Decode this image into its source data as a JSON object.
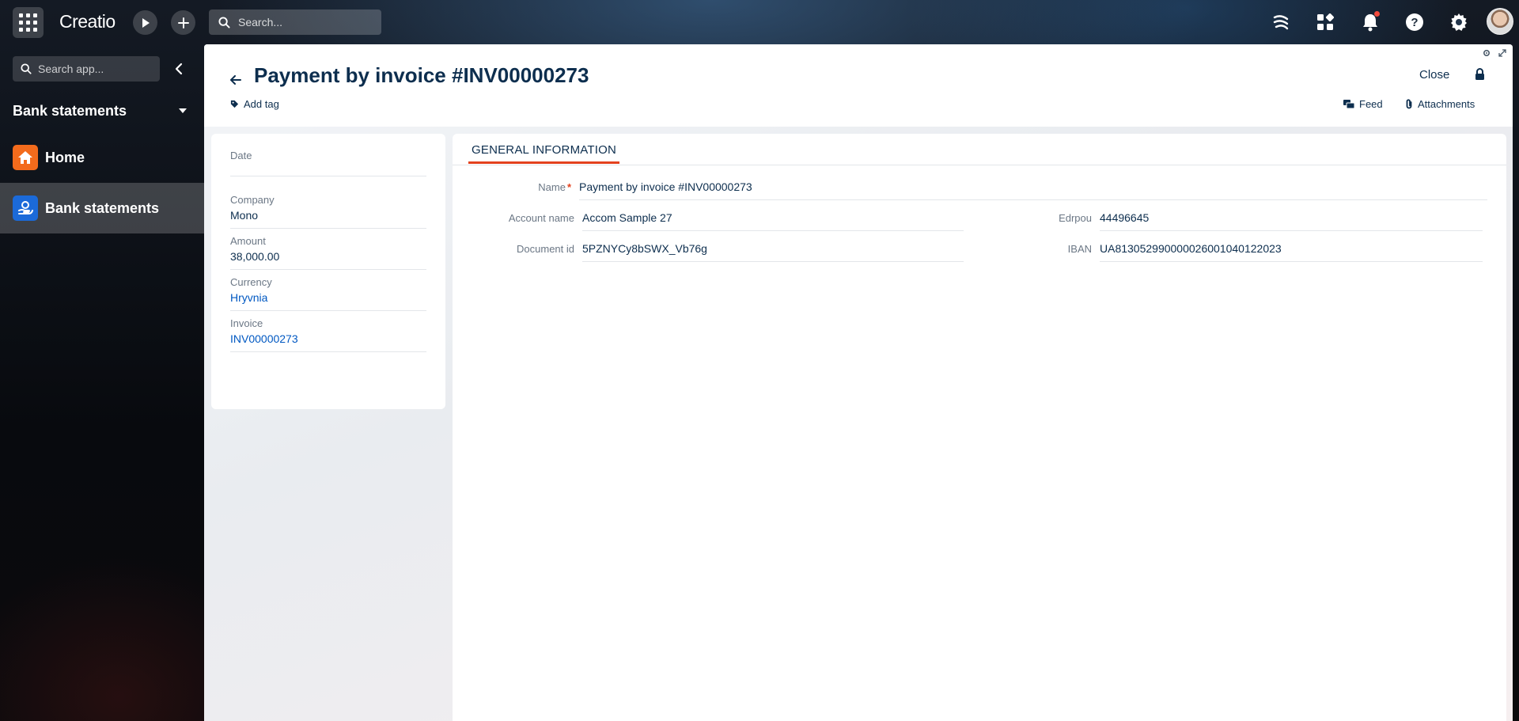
{
  "topbar": {
    "logo": "Creatio",
    "search_placeholder": "Search..."
  },
  "sidebar": {
    "search_placeholder": "Search app...",
    "workspace": "Bank statements",
    "items": [
      {
        "label": "Home",
        "icon": "home-icon",
        "color": "#f36b1c"
      },
      {
        "label": "Bank statements",
        "icon": "bank-statements-icon",
        "color": "#1b6ad9"
      }
    ]
  },
  "header": {
    "title": "Payment by invoice #INV00000273",
    "add_tag": "Add tag",
    "close": "Close",
    "feed": "Feed",
    "attachments": "Attachments"
  },
  "details": [
    {
      "label": "Date",
      "value": ""
    },
    {
      "label": "Company",
      "value": "Mono"
    },
    {
      "label": "Amount",
      "value": "38,000.00"
    },
    {
      "label": "Currency",
      "value": "Hryvnia"
    },
    {
      "label": "Invoice",
      "value": "INV00000273"
    }
  ],
  "general": {
    "tab": "GENERAL INFORMATION",
    "name_label": "Name",
    "name_value": "Payment by invoice #INV00000273",
    "account_name_label": "Account name",
    "account_name_value": "Accom Sample 27",
    "document_id_label": "Document id",
    "document_id_value": "5PZNYCy8bSWX_Vb76g",
    "edrpou_label": "Edrpou",
    "edrpou_value": "44496645",
    "iban_label": "IBAN",
    "iban_value": "UA813052990000026001040122023"
  },
  "colors": {
    "accent": "#e3421e",
    "link": "#0058c2",
    "text": "#0d2e4e"
  }
}
